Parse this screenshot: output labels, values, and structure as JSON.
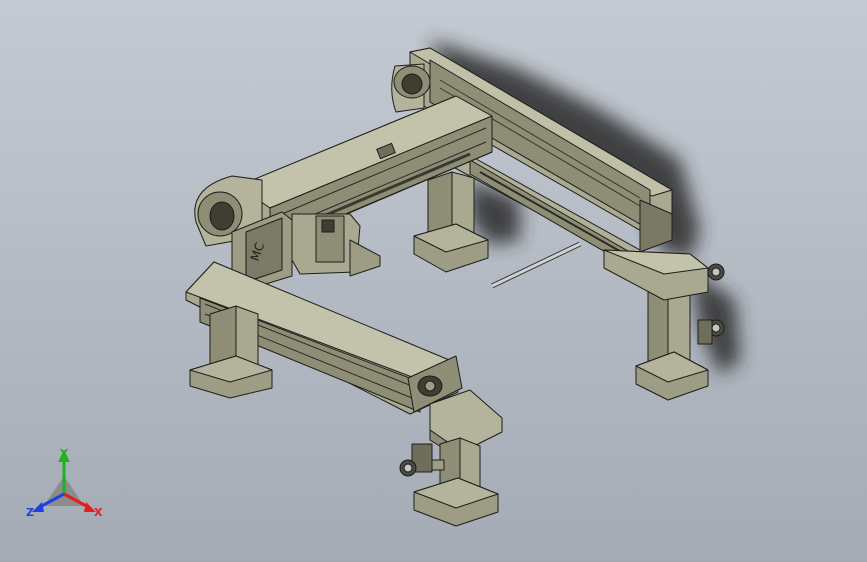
{
  "viewport": {
    "background_top": "#c4cad2",
    "background_bottom": "#a4abb5",
    "model_colors": {
      "face_light": "#a9a890",
      "face_mid": "#8e8d75",
      "face_dark": "#6f6e5a",
      "edge": "#1e1e1a",
      "rod": "#cfd2d4",
      "shadow": "#2a2a2a"
    },
    "model_name": "gantry-assembly"
  },
  "triad": {
    "x_label": "X",
    "y_label": "Y",
    "z_label": "Z",
    "x_color": "#e02020",
    "y_color": "#20b020",
    "z_color": "#2040e0"
  }
}
